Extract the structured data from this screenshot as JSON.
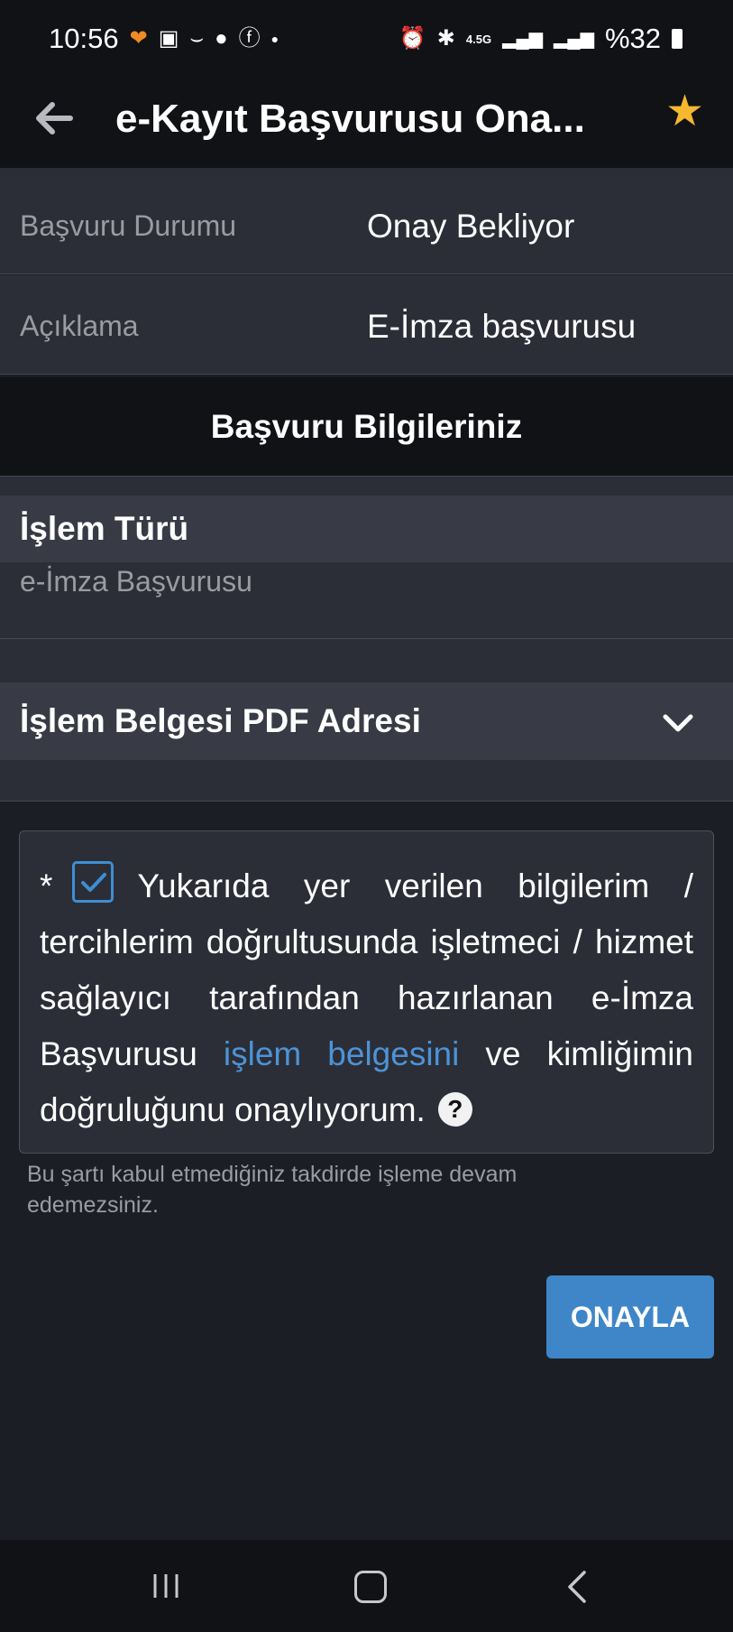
{
  "statusbar": {
    "time": "10:56",
    "network": "4.5G",
    "battery": "%32"
  },
  "appbar": {
    "title": "e-Kayıt Başvurusu Ona..."
  },
  "info_rows": [
    {
      "label": "Başvuru Durumu",
      "value": "Onay Bekliyor"
    },
    {
      "label": "Açıklama",
      "value": "E-İmza başvurusu"
    }
  ],
  "section": {
    "title": "Başvuru Bilgileriniz"
  },
  "islem_turu": {
    "title": "İşlem Türü",
    "value": "e-İmza Başvurusu"
  },
  "pdf_panel": {
    "title": "İşlem Belgesi PDF Adresi"
  },
  "consent": {
    "asterisk": "*",
    "text_before": "Yukarıda yer verilen bilgilerim / tercihlerim doğrultusunda işletmeci / hizmet sağlayıcı tarafından hazırlanan e-İmza Başvurusu ",
    "link_text": "işlem belgesini",
    "text_after": " ve kimliğimin doğruluğunu onaylıyorum.",
    "checked": true,
    "help": "?"
  },
  "hint": "Bu şartı kabul etmediğiniz takdirde işleme devam edemezsiniz.",
  "approve_button": "ONAYLA",
  "colors": {
    "accent": "#3e86c8",
    "link": "#4d93d6",
    "star": "#f5b82e"
  }
}
